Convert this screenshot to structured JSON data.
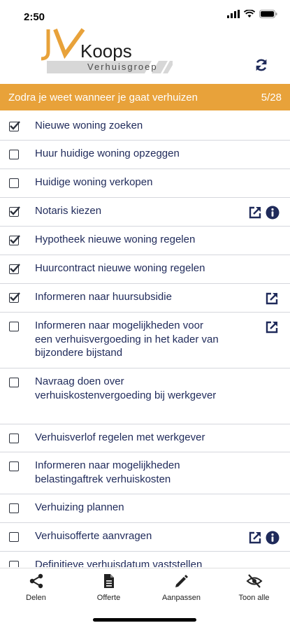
{
  "status": {
    "time": "2:50"
  },
  "header": {
    "brand": "Koops",
    "subtitle": "Verhuisgroep",
    "sync_icon": "refresh-icon"
  },
  "section": {
    "title": "Zodra je weet wanneer je gaat verhuizen",
    "count": "5/28",
    "color": "#e8a23a"
  },
  "items": [
    {
      "label": "Nieuwe woning zoeken",
      "checked": true,
      "ext": false,
      "info": false
    },
    {
      "label": "Huur huidige woning opzeggen",
      "checked": false,
      "ext": false,
      "info": false
    },
    {
      "label": "Huidige woning verkopen",
      "checked": false,
      "ext": false,
      "info": false
    },
    {
      "label": "Notaris kiezen",
      "checked": true,
      "ext": true,
      "info": true
    },
    {
      "label": "Hypotheek nieuwe woning regelen",
      "checked": true,
      "ext": false,
      "info": false
    },
    {
      "label": "Huurcontract nieuwe woning regelen",
      "checked": true,
      "ext": false,
      "info": false
    },
    {
      "label": "Informeren naar huursubsidie",
      "checked": true,
      "ext": true,
      "info": false
    },
    {
      "label": "Informeren naar mogelijkheden voor een verhuisvergoeding in het kader van bijzondere bijstand",
      "checked": false,
      "ext": true,
      "info": false
    },
    {
      "label": "Navraag doen over verhuiskostenvergoeding bij werkgever",
      "checked": false,
      "ext": false,
      "info": false
    },
    {
      "label": "Verhuisverlof regelen met werkgever",
      "checked": false,
      "ext": false,
      "info": false
    },
    {
      "label": "Informeren naar mogelijkheden belastingaftrek verhuiskosten",
      "checked": false,
      "ext": false,
      "info": false
    },
    {
      "label": "Verhuizing plannen",
      "checked": false,
      "ext": false,
      "info": false
    },
    {
      "label": "Verhuisofferte aanvragen",
      "checked": false,
      "ext": true,
      "info": true
    },
    {
      "label": "Definitieve verhuisdatum vaststellen",
      "checked": false,
      "ext": false,
      "info": false
    }
  ],
  "tabs": [
    {
      "label": "Delen",
      "icon": "share-icon"
    },
    {
      "label": "Offerte",
      "icon": "document-icon"
    },
    {
      "label": "Aanpassen",
      "icon": "pencil-icon"
    },
    {
      "label": "Toon alle",
      "icon": "eye-slash-icon"
    }
  ]
}
